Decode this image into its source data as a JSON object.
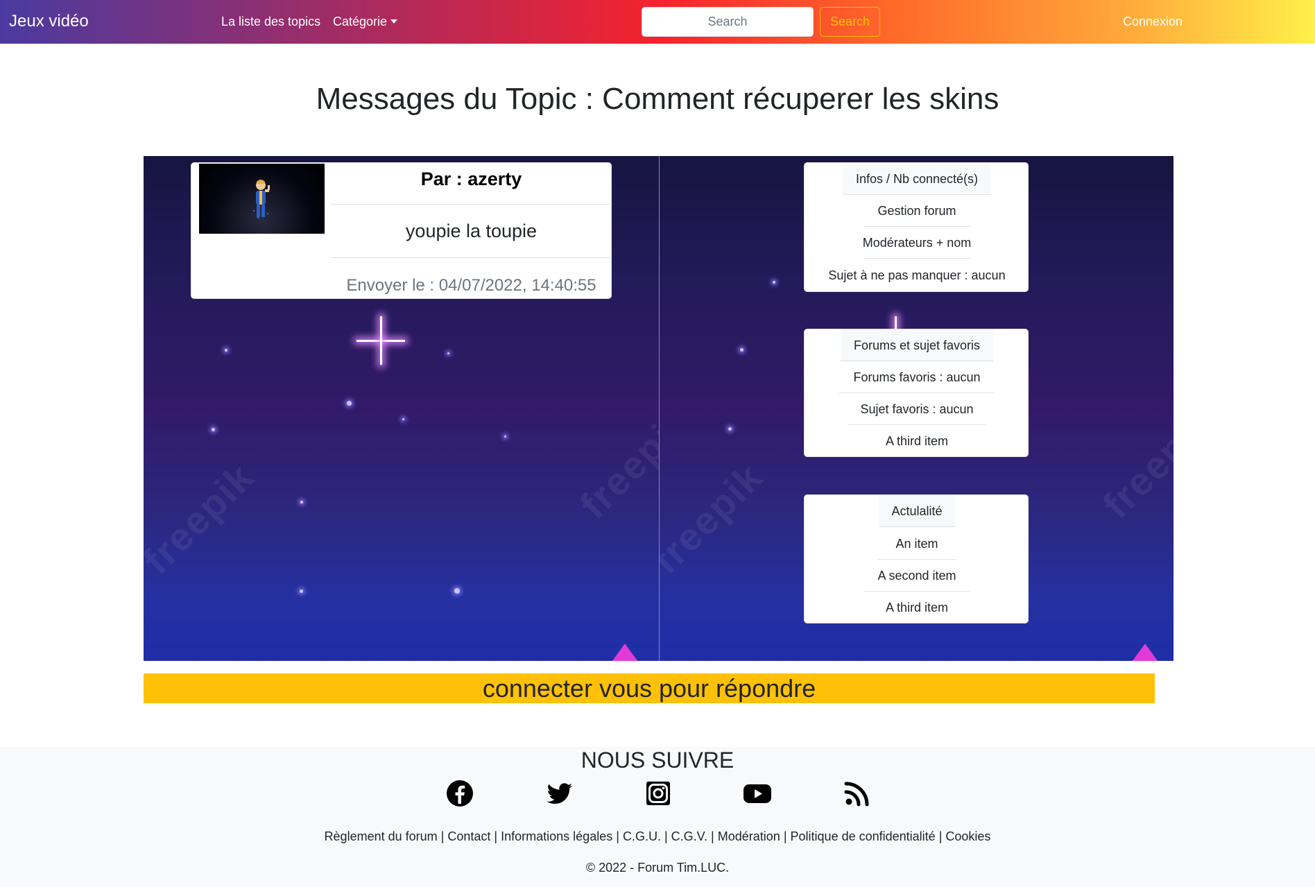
{
  "navbar": {
    "brand": "Jeux vidéo",
    "topics_link": "La liste des topics",
    "category_link": "Catégorie",
    "search_placeholder": "Search",
    "search_button": "Search",
    "login_link": "Connexion"
  },
  "page": {
    "title": "Messages du Topic : Comment récuperer les skins"
  },
  "message": {
    "author": "Par : azerty",
    "body": "youpie la toupie",
    "date": "Envoyer le : 04/07/2022, 14:40:55"
  },
  "sidebar": {
    "infos": {
      "header": "Infos / Nb connecté(s)",
      "items": [
        "Gestion forum",
        "Modérateurs + nom",
        "Sujet à ne pas manquer : aucun"
      ]
    },
    "favorites": {
      "header": "Forums et sujet favoris",
      "items": [
        "Forums favoris : aucun",
        "Sujet favoris : aucun",
        "A third item"
      ]
    },
    "news": {
      "header": "Actulalité",
      "items": [
        "An item",
        "A second item",
        "A third item"
      ]
    }
  },
  "background": {
    "watermark": "freepik"
  },
  "reply": {
    "label": "connecter vous pour répondre"
  },
  "footer": {
    "follow_title": "NOUS SUIVRE",
    "social_icons": [
      "facebook-icon",
      "twitter-icon",
      "instagram-icon",
      "youtube-icon",
      "rss-icon"
    ],
    "links": [
      "Règlement du forum",
      "Contact",
      "Informations légales",
      "C.G.U.",
      "C.G.V.",
      "Modération",
      "Politique de confidentialité",
      "Cookies"
    ],
    "copyright": "© 2022 - Forum Tim.LUC."
  },
  "colors": {
    "accent_warning": "#ffc107",
    "text_dark": "#212529",
    "muted": "#6c757d"
  }
}
